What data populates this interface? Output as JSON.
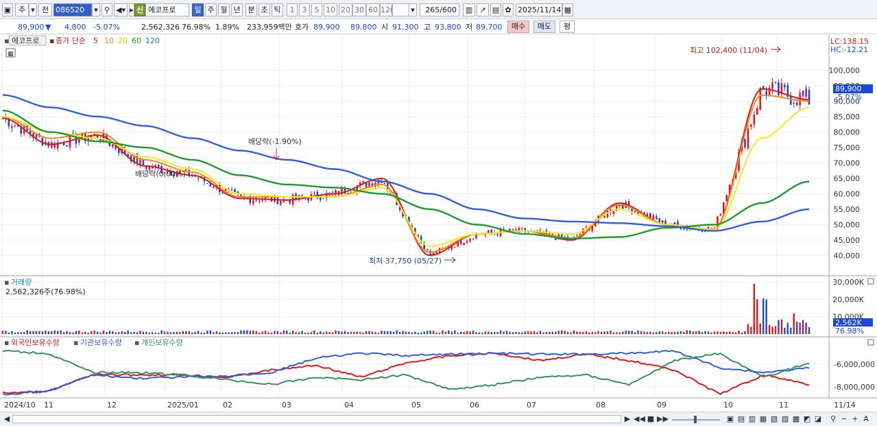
{
  "toolbar": {
    "period_main": "주",
    "prev_label": "전",
    "stock_code": "086520",
    "new_badge": "신",
    "stock_name": "에코프로",
    "period_tabs": [
      "일",
      "주",
      "월",
      "년",
      "분",
      "초",
      "틱"
    ],
    "active_tab": "일",
    "interval_buttons": [
      "1",
      "3",
      "5",
      "10",
      "20",
      "30",
      "60",
      "120"
    ],
    "bar_count": "265",
    "bar_total": "/600",
    "date": "2025/11/14"
  },
  "quote": {
    "price": "89,900",
    "change": "4,800",
    "change_pct": "-5.07%",
    "volume": "2,562,326",
    "vol_ratio": "76.98%",
    "turnover_pct": "1.89%",
    "amount": "233,959백만",
    "ask_label": "호가",
    "ask": "89,900",
    "bid": "89,800",
    "open_label": "시",
    "open": "91,300",
    "high_label": "고",
    "high": "93,800",
    "low_label": "저",
    "low": "89,700",
    "buy_button": "매수",
    "sell_button": "매도",
    "avg_button": "평"
  },
  "legend": {
    "name": "에코프로",
    "close_label": "종가 단순",
    "ma": [
      "5",
      "10",
      "20",
      "60",
      "120"
    ],
    "lc": "LC:138.15",
    "hc": "HC:-12.21"
  },
  "annotations": {
    "high": "최고 102,400 (11/04)",
    "low": "최저 37,750 (05/27)",
    "div1": "배당락(-1.90%)",
    "div2": "배당락(0.00%)"
  },
  "price_panel": {
    "last_price": "89,900",
    "last_change": "-5.07%"
  },
  "volume_panel": {
    "title": "거래량",
    "sub": "2,562,326주(76.98%)",
    "last_label": "2,562K",
    "last_pct": "76.98%"
  },
  "holding_panel": {
    "legend": [
      "외국인보유수량",
      "기관보유수량",
      "개인보유수량"
    ]
  },
  "x_axis_labels": [
    "2024/10",
    "11",
    "12",
    "2025/01",
    "02",
    "03",
    "04",
    "05",
    "06",
    "07",
    "08",
    "09",
    "10",
    "11",
    "11/14"
  ],
  "colors": {
    "up": "#e01818",
    "down": "#1848d8",
    "ma5": "#e01818",
    "ma10": "#f08a1a",
    "ma20": "#f6e81e",
    "ma60": "#1f9a2e",
    "ma120": "#2f5fe0",
    "foreign": "#e01818",
    "institution": "#2f5fe0",
    "individual": "#3a8f5a"
  },
  "chart_data": [
    {
      "type": "candlestick",
      "title": "에코프로",
      "series": [
        {
          "name": "5",
          "values": [
            84500,
            76000,
            79000,
            69000,
            66000,
            58500,
            58000,
            60000,
            65000,
            40000,
            47000,
            48000,
            45000,
            57000,
            50000,
            48500,
            94000,
            90500
          ]
        },
        {
          "name": "10",
          "values": [
            85000,
            78000,
            80000,
            71000,
            67000,
            59000,
            59000,
            59000,
            63000,
            41000,
            47000,
            48000,
            45500,
            56500,
            50000,
            48500,
            92000,
            90000
          ]
        },
        {
          "name": "20",
          "values": [
            85000,
            80000,
            78000,
            72000,
            68000,
            60000,
            59000,
            59000,
            62000,
            43000,
            47000,
            48000,
            47000,
            55000,
            50000,
            48500,
            78000,
            88000
          ]
        },
        {
          "name": "60",
          "values": [
            87000,
            80000,
            77000,
            75000,
            71000,
            66000,
            63000,
            62000,
            60000,
            55000,
            50000,
            47000,
            45500,
            46000,
            49000,
            50000,
            57000,
            64000
          ]
        },
        {
          "name": "120",
          "values": [
            92000,
            88000,
            85000,
            82000,
            78000,
            74000,
            71000,
            68000,
            64000,
            60000,
            55000,
            52000,
            51000,
            50500,
            49500,
            48000,
            51000,
            55000
          ]
        }
      ],
      "categories": [
        "2024/10",
        "11",
        "12",
        "2025/01",
        "02",
        "03",
        "04",
        "05",
        "06",
        "07",
        "08",
        "09",
        "10",
        "11"
      ],
      "ylim": [
        35000,
        105000
      ],
      "yticks": [
        40000,
        45000,
        50000,
        55000,
        60000,
        65000,
        70000,
        75000,
        80000,
        85000,
        90000,
        95000,
        100000
      ],
      "ytick_labels": [
        "40,000",
        "45,000",
        "50,000",
        "55,000",
        "60,000",
        "65,000",
        "70,000",
        "75,000",
        "80,000",
        "85,000",
        "90,000",
        "95,000",
        "100,000"
      ],
      "high": 102400,
      "low": 37750
    },
    {
      "type": "bar",
      "title": "거래량",
      "ylim": [
        0,
        32000000
      ],
      "ytick_labels": [
        "10,000K",
        "20,000K",
        "30,000K"
      ],
      "spike_values": [
        29000000,
        20000000,
        20000000,
        20500000,
        12000000
      ]
    },
    {
      "type": "line",
      "series": [
        {
          "name": "외국인보유수량"
        },
        {
          "name": "기관보유수량"
        },
        {
          "name": "개인보유수량"
        }
      ],
      "ytick_labels": [
        "-6,000,000",
        "-8,000,000"
      ]
    }
  ]
}
